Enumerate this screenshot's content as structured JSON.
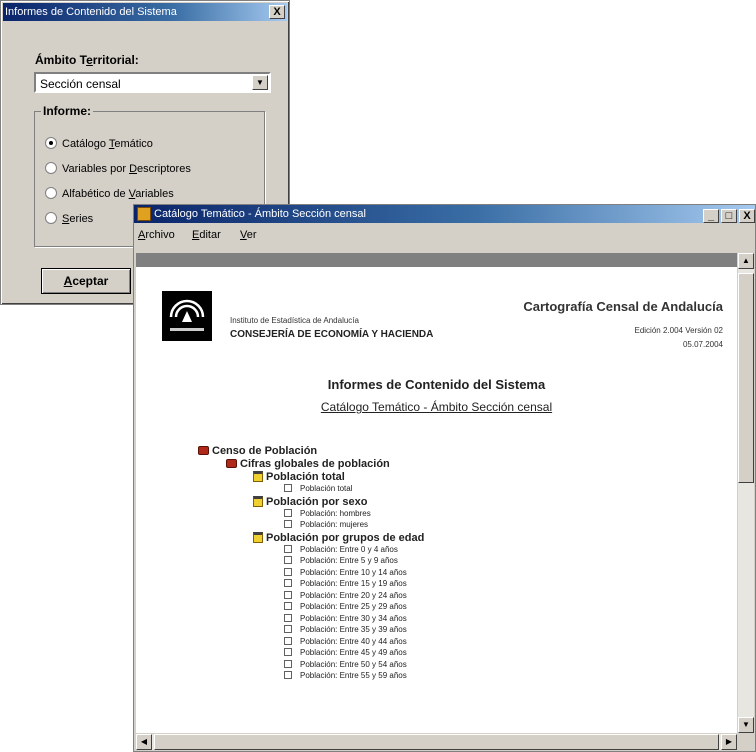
{
  "dialog": {
    "title": "Informes de Contenido del Sistema",
    "close_label": "X",
    "ambito_pre": "Ámbito T",
    "ambito_accel": "e",
    "ambito_post": "rritorial:",
    "select_value": "Sección censal",
    "informe_label": "Informe:",
    "options": [
      {
        "pre": "Catálogo ",
        "accel": "T",
        "post": "emático",
        "selected": true
      },
      {
        "pre": "Variables por ",
        "accel": "D",
        "post": "escriptores",
        "selected": false
      },
      {
        "pre": "Alfabético de ",
        "accel": "V",
        "post": "ariables",
        "selected": false
      },
      {
        "pre": "",
        "accel": "S",
        "post": "eries",
        "selected": false
      }
    ],
    "accept_accel": "A",
    "accept_post": "ceptar"
  },
  "window": {
    "title": "Catálogo Temático - Ámbito Sección censal",
    "minimize": "_",
    "maximize": "□",
    "close": "X",
    "menu": [
      {
        "accel": "A",
        "rest": "rchivo"
      },
      {
        "accel": "E",
        "rest": "ditar"
      },
      {
        "accel": "V",
        "rest": "er"
      }
    ]
  },
  "report": {
    "institute": "Instituto de Estadística de Andalucía",
    "consejeria": "CONSEJERÍA DE ECONOMÍA Y HACIENDA",
    "logo_text": "JUNTA DE ANDALUCIA",
    "cartografia": "Cartografía Censal de Andalucía",
    "edicion": "Edición 2.004 Versión 02",
    "fecha": "05.07.2004",
    "title": "Informes de Contenido del Sistema",
    "subtitle": "Catálogo Temático - Ámbito Sección censal",
    "tree": [
      {
        "level": 0,
        "icon": "book-icon",
        "label": "Censo de Población"
      },
      {
        "level": 1,
        "icon": "book-icon",
        "label": "Cifras globales de población"
      },
      {
        "level": 2,
        "icon": "clipboard-icon",
        "label": "Población total"
      },
      {
        "level": 3,
        "icon": "checkbox-icon",
        "label": "Población total"
      },
      {
        "level": 2,
        "icon": "clipboard-icon",
        "label": "Población por sexo"
      },
      {
        "level": 3,
        "icon": "checkbox-icon",
        "label": "Población: hombres"
      },
      {
        "level": 3,
        "icon": "checkbox-icon",
        "label": "Población: mujeres"
      },
      {
        "level": 2,
        "icon": "clipboard-icon",
        "label": "Población por grupos de edad"
      },
      {
        "level": 3,
        "icon": "checkbox-icon",
        "label": "Población: Entre 0 y 4 años"
      },
      {
        "level": 3,
        "icon": "checkbox-icon",
        "label": "Población: Entre 5 y 9 años"
      },
      {
        "level": 3,
        "icon": "checkbox-icon",
        "label": "Población: Entre 10 y 14 años"
      },
      {
        "level": 3,
        "icon": "checkbox-icon",
        "label": "Población: Entre 15 y 19 años"
      },
      {
        "level": 3,
        "icon": "checkbox-icon",
        "label": "Población: Entre 20 y 24 años"
      },
      {
        "level": 3,
        "icon": "checkbox-icon",
        "label": "Población: Entre 25 y 29 años"
      },
      {
        "level": 3,
        "icon": "checkbox-icon",
        "label": "Población: Entre 30 y 34 años"
      },
      {
        "level": 3,
        "icon": "checkbox-icon",
        "label": "Población: Entre 35 y 39 años"
      },
      {
        "level": 3,
        "icon": "checkbox-icon",
        "label": "Población: Entre 40 y 44 años"
      },
      {
        "level": 3,
        "icon": "checkbox-icon",
        "label": "Población: Entre 45 y 49 años"
      },
      {
        "level": 3,
        "icon": "checkbox-icon",
        "label": "Población: Entre 50 y 54 años"
      },
      {
        "level": 3,
        "icon": "checkbox-icon",
        "label": "Población: Entre 55 y 59 años"
      }
    ]
  }
}
